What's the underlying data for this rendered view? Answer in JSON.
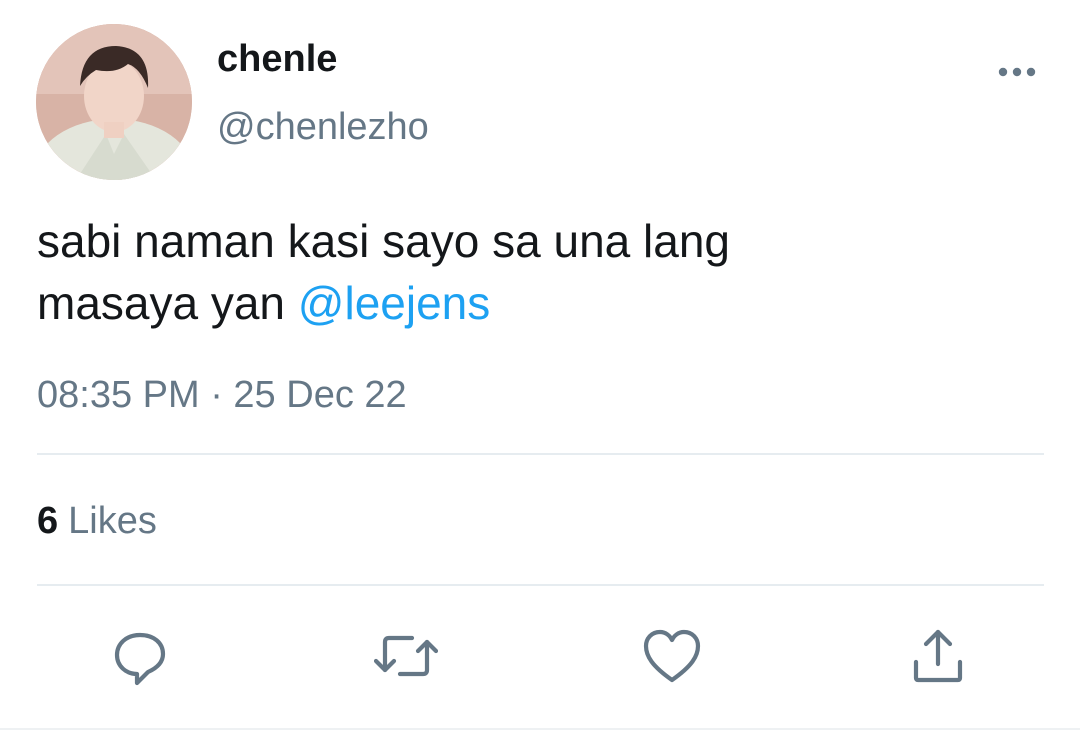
{
  "tweet": {
    "author": {
      "display_name": "chenle",
      "handle": "@chenlezho",
      "avatar_icon": "profile-photo"
    },
    "more_icon": "more-horizontal-icon",
    "text_line1": "sabi naman kasi sayo sa una lang",
    "text_line2_prefix": "masaya yan ",
    "mention": "@leejens",
    "timestamp": "08:35 PM · 25 Dec 22",
    "likes_count": "6",
    "likes_label": "Likes"
  },
  "actions": [
    {
      "name": "reply",
      "icon": "comment-icon"
    },
    {
      "name": "retweet",
      "icon": "retweet-icon"
    },
    {
      "name": "like",
      "icon": "heart-icon"
    },
    {
      "name": "share",
      "icon": "share-icon"
    }
  ],
  "colors": {
    "text_primary": "#14171a",
    "text_secondary": "#657786",
    "link": "#1da1f2",
    "divider": "#e6ecf0"
  }
}
